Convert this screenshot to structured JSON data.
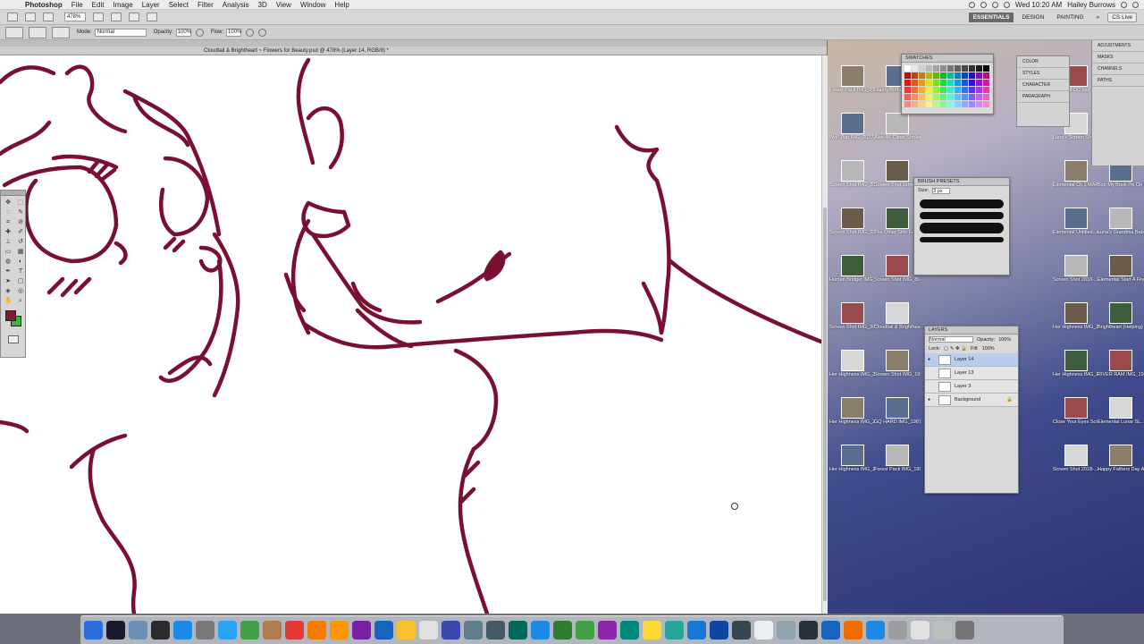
{
  "menubar": {
    "app_name": "Photoshop",
    "items": [
      "File",
      "Edit",
      "Image",
      "Layer",
      "Select",
      "Filter",
      "Analysis",
      "3D",
      "View",
      "Window",
      "Help"
    ],
    "clock": "Wed 10:20 AM",
    "user": "Hailey Burrows"
  },
  "appbar": {
    "zoom": "478%",
    "workspaces": [
      "ESSENTIALS",
      "DESIGN",
      "PAINTING"
    ],
    "active_workspace": "ESSENTIALS",
    "cs_live": "CS Live"
  },
  "options": {
    "mode_label": "Mode:",
    "mode_value": "Normal",
    "opacity_label": "Opacity:",
    "opacity_value": "100%",
    "flow_label": "Flow:",
    "flow_value": "100%"
  },
  "document": {
    "title": "Cloudtail & Brightheart ~ Flowers for Beauty.psd @ 478% (Layer 14, RGB/8) *"
  },
  "colors": {
    "foreground": "#7a1b3a",
    "background": "#3cb43c",
    "line": "#7a1030"
  },
  "panels": {
    "swatches_title": "SWATCHES",
    "brush_presets_title": "BRUSH PRESETS",
    "brush_size_label": "Size:",
    "brush_size_value": "3 px",
    "layers_title": "LAYERS",
    "layers_mode": "Normal",
    "layers_opacity_label": "Opacity:",
    "layers_opacity": "100%",
    "layers_lock_label": "Lock:",
    "layers_fill_label": "Fill:",
    "layers_fill": "100%",
    "layers": [
      "Layer 14",
      "Layer 13",
      "Layer 3",
      "Background"
    ],
    "selected_layer": "Layer 14",
    "middle_dock": [
      "COLOR",
      "STYLES",
      "CHARACTER",
      "PARAGRAPH"
    ],
    "right_dock": [
      "ADJUSTMENTS",
      "MASKS",
      "CHANNELS",
      "PATHS"
    ]
  },
  "desktop_icons": [
    "Forest Pack IMG_2018.jpg",
    "Happy Birthday Mr Kate.png",
    "Wolf OC.psd",
    "Mother's Screen Shot 2018...",
    "Wolf Pup IMG_2027.jpg",
    "Alex 4K Clean Stroke.mov",
    "Luna's Screen Shot 2018-...47 AM",
    "Elemental Fera Chron...am.psd",
    "Screen Shot IMG_2038.jpg",
    "Screen Shot James Arthur Say yo...p3",
    "Elemental Ch 1 MAP...5).psd",
    "Bop My Book I'm On My Way...).mov",
    "Screen Shot IMG_2041.jpg",
    "The Other Side Fe 2017-...7.27",
    "Elemental Untitled...ennial.psd",
    "Luna's Grandma Babs.png",
    "Human Bridget IMG_2047.jpg",
    "Screen Shot IMG_8042.jpg",
    "Screen Shot 2018-...7.51 PM",
    "Elemental Start A Fire (MAP)...M.wmv",
    "Screen Shot IMG_2058.jpg",
    "Cloudtail & Brightheart",
    "Her Highness IMG_2112.jpg",
    "Brightheart (Helping) and ...p3",
    "Her Highness IMG_2119.jpg",
    "Screen Shot IMG_1953.jpg",
    "Her Highness IMG_2160.jpg",
    "RIVER RAM IMG_1967.jpg",
    "Her Highness IMG_2165.jpg",
    "GQ HARD IMG_1987.jpg",
    "Close Your Eyes Screen Shot 2018...",
    "Elemental Lunar SL...mp4",
    "Her Highness IMG_2070.jpg",
    "Forest Pack IMG_1995.jpg",
    "Screen Shot 2018-...AM.psd",
    "Happy Fathers Day Ancient Magus Bride...mp4"
  ]
}
